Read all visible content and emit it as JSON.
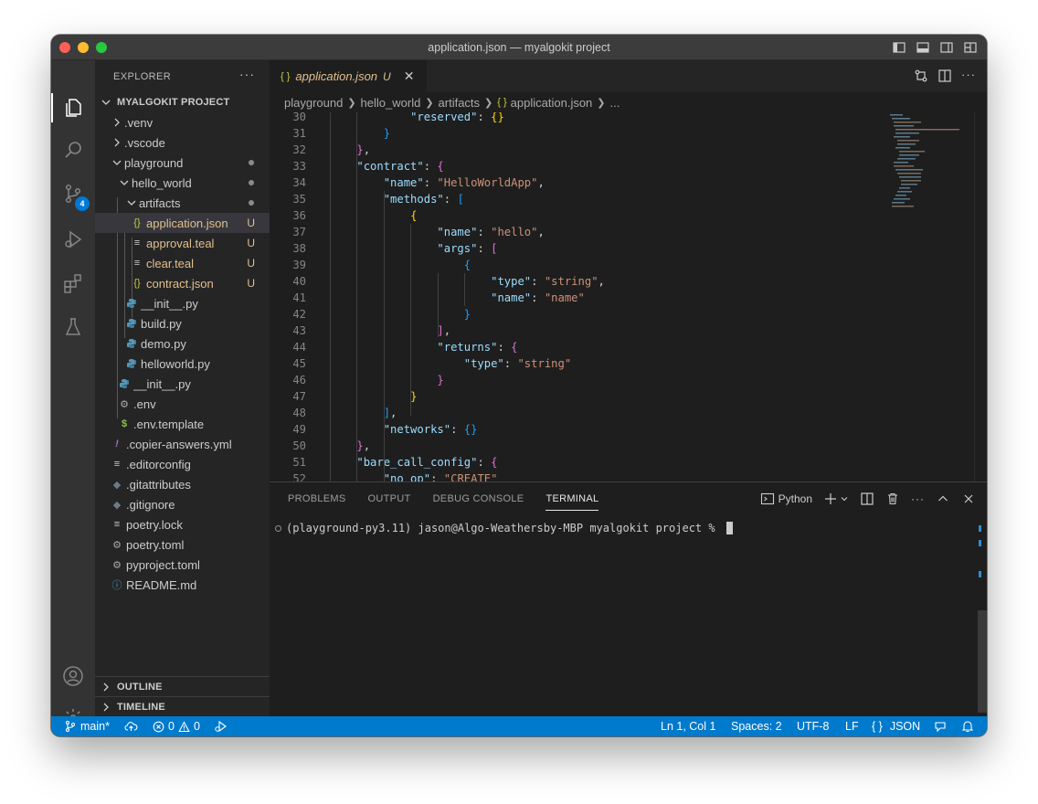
{
  "window": {
    "title": "application.json — myalgokit project"
  },
  "activity_bar": {
    "source_control_badge": "4"
  },
  "sidebar": {
    "title": "EXPLORER",
    "more": "···",
    "project": "MYALGOKIT PROJECT",
    "items": [
      {
        "label": ".venv",
        "type": "folder-collapsed"
      },
      {
        "label": ".vscode",
        "type": "folder-collapsed"
      },
      {
        "label": "playground",
        "type": "folder-open"
      },
      {
        "label": "hello_world",
        "type": "folder-open"
      },
      {
        "label": "artifacts",
        "type": "folder-open"
      },
      {
        "label": "application.json",
        "type": "json",
        "decoration": "U"
      },
      {
        "label": "approval.teal",
        "type": "text",
        "decoration": "U"
      },
      {
        "label": "clear.teal",
        "type": "text",
        "decoration": "U"
      },
      {
        "label": "contract.json",
        "type": "json",
        "decoration": "U"
      },
      {
        "label": "__init__.py",
        "type": "python"
      },
      {
        "label": "build.py",
        "type": "python"
      },
      {
        "label": "demo.py",
        "type": "python"
      },
      {
        "label": "helloworld.py",
        "type": "python"
      },
      {
        "label": "__init__.py",
        "type": "python"
      },
      {
        "label": ".env",
        "type": "gear"
      },
      {
        "label": ".env.template",
        "type": "dollar"
      },
      {
        "label": ".copier-answers.yml",
        "type": "yaml"
      },
      {
        "label": ".editorconfig",
        "type": "text"
      },
      {
        "label": ".gitattributes",
        "type": "git"
      },
      {
        "label": ".gitignore",
        "type": "git"
      },
      {
        "label": "poetry.lock",
        "type": "text"
      },
      {
        "label": "poetry.toml",
        "type": "gear"
      },
      {
        "label": "pyproject.toml",
        "type": "gear"
      },
      {
        "label": "README.md",
        "type": "info"
      }
    ],
    "outline": "OUTLINE",
    "timeline": "TIMELINE"
  },
  "editor": {
    "tab": {
      "icon": "{ }",
      "name": "application.json",
      "decoration": "U"
    },
    "breadcrumb": [
      "playground",
      "hello_world",
      "artifacts",
      "application.json",
      "..."
    ],
    "lines": [
      {
        "n": "30",
        "code": "            \"reserved\": {}"
      },
      {
        "n": "31",
        "code": "        }"
      },
      {
        "n": "32",
        "code": "    },"
      },
      {
        "n": "33",
        "code": "    \"contract\": {"
      },
      {
        "n": "34",
        "code": "        \"name\": \"HelloWorldApp\","
      },
      {
        "n": "35",
        "code": "        \"methods\": ["
      },
      {
        "n": "36",
        "code": "            {"
      },
      {
        "n": "37",
        "code": "                \"name\": \"hello\","
      },
      {
        "n": "38",
        "code": "                \"args\": ["
      },
      {
        "n": "39",
        "code": "                    {"
      },
      {
        "n": "40",
        "code": "                        \"type\": \"string\","
      },
      {
        "n": "41",
        "code": "                        \"name\": \"name\""
      },
      {
        "n": "42",
        "code": "                    }"
      },
      {
        "n": "43",
        "code": "                ],"
      },
      {
        "n": "44",
        "code": "                \"returns\": {"
      },
      {
        "n": "45",
        "code": "                    \"type\": \"string\""
      },
      {
        "n": "46",
        "code": "                }"
      },
      {
        "n": "47",
        "code": "            }"
      },
      {
        "n": "48",
        "code": "        ],"
      },
      {
        "n": "49",
        "code": "        \"networks\": {}"
      },
      {
        "n": "50",
        "code": "    },"
      },
      {
        "n": "51",
        "code": "    \"bare_call_config\": {"
      },
      {
        "n": "52",
        "code": "        \"no_op\": \"CREATE\""
      }
    ]
  },
  "panel": {
    "tabs": [
      "PROBLEMS",
      "OUTPUT",
      "DEBUG CONSOLE",
      "TERMINAL"
    ],
    "active_tab": "TERMINAL",
    "terminal_profile": "Python",
    "terminal_prompt": "(playground-py3.11) jason@Algo-Weathersby-MBP myalgokit project % "
  },
  "statusbar": {
    "branch": "main*",
    "errors": "0",
    "warnings": "0",
    "position": "Ln 1, Col 1",
    "spaces": "Spaces: 2",
    "encoding": "UTF-8",
    "eol": "LF",
    "language": "JSON",
    "language_icon": "{ }"
  },
  "colors": {
    "accent": "#007acc",
    "untracked": "#e2c08d",
    "json_key": "#9cdcfe",
    "json_string": "#ce9178"
  }
}
